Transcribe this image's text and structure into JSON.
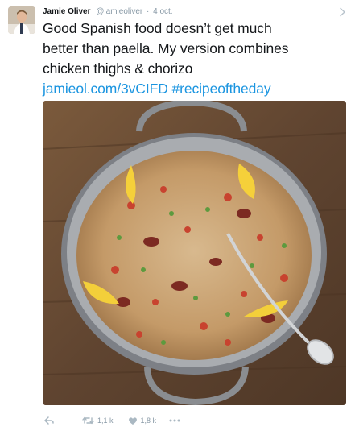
{
  "tweet": {
    "author_name": "Jamie Oliver",
    "handle": "@jamieoliver",
    "separator": "·",
    "timestamp": "4 oct.",
    "text_line1": "Good Spanish food doesn’t get much",
    "text_line2": "better than paella. My version combines",
    "text_line3": "chicken thighs & chorizo",
    "link_url": "jamieol.com/3vCIFD",
    "hashtag": "#recipeoftheday"
  },
  "actions": {
    "reply_icon": "reply-icon",
    "retweet_icon": "retweet-icon",
    "retweet_count": "1,1 k",
    "like_icon": "heart-icon",
    "like_count": "1,8 k",
    "more_icon": "more-dots-icon"
  },
  "colors": {
    "link": "#1b95e0",
    "text": "#14171a",
    "muted": "#8899a6"
  }
}
